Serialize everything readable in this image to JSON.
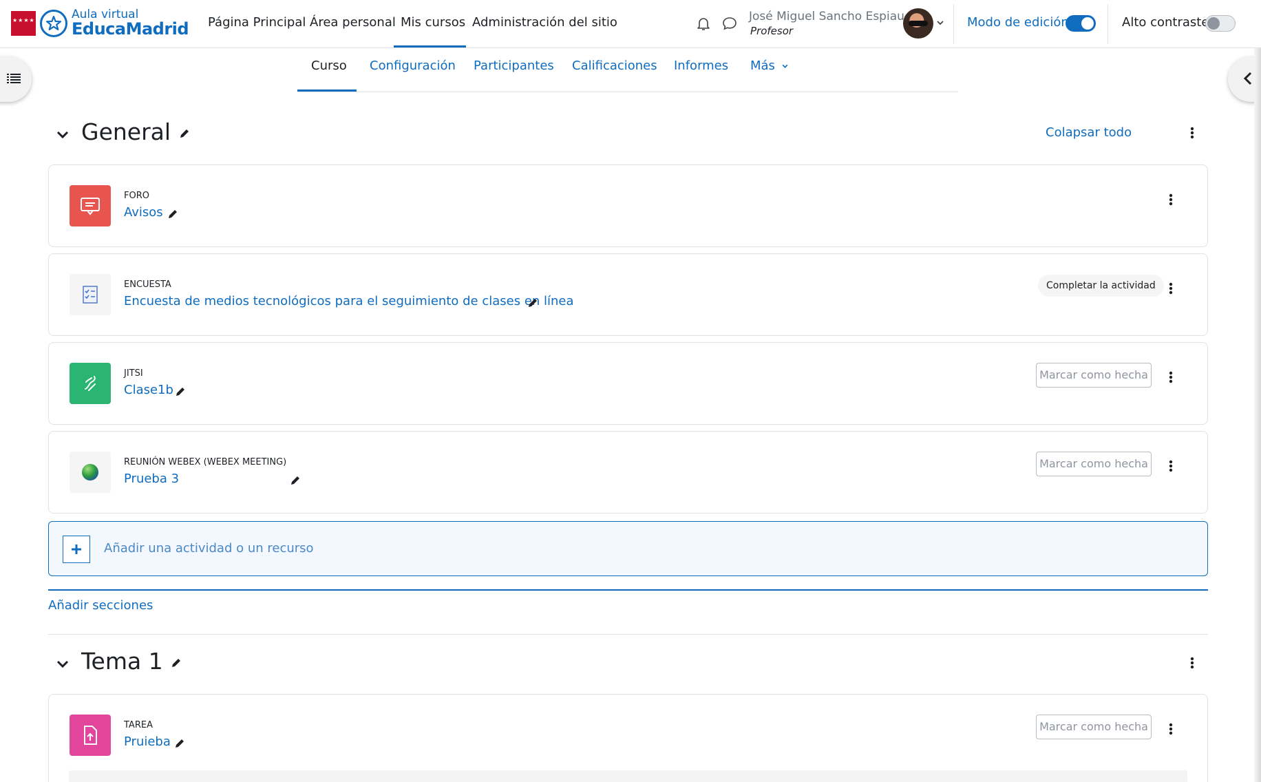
{
  "brand": {
    "top": "Aula virtual",
    "bottom": "EducaMadrid",
    "flag_stars": "★★★★",
    "brand_color": "#0f6cbf",
    "flag_color": "#c8102e"
  },
  "main_nav": {
    "items": [
      "Página Principal",
      "Área personal",
      "Mis cursos",
      "Administración del sitio"
    ],
    "active": "Mis cursos"
  },
  "header": {
    "notifications_icon": "bell-icon",
    "messages_icon": "chat-bubble-icon",
    "user_name": "José Miguel Sancho Espiau",
    "user_role": "Profesor",
    "edit_mode_label": "Modo de edición",
    "edit_mode_on": true,
    "contrast_label": "Alto contraste",
    "contrast_on": false
  },
  "course_nav": {
    "items": [
      "Curso",
      "Configuración",
      "Participantes",
      "Calificaciones",
      "Informes",
      "Más"
    ],
    "active": "Curso"
  },
  "sections": [
    {
      "title": "General",
      "collapse_all": "Colapsar todo",
      "activities": [
        {
          "type": "FORO",
          "name": "Avisos",
          "icon": "forum-icon",
          "color": "#e8544e"
        },
        {
          "type": "ENCUESTA",
          "name": "Encuesta de medios tecnológicos para el seguimiento de clases en línea",
          "icon": "survey-icon",
          "completion": "Completar la actividad"
        },
        {
          "type": "JITSI",
          "name": "Clase1b",
          "icon": "jitsi-icon",
          "color": "#2bb573",
          "completion": "Marcar como hecha"
        },
        {
          "type": "REUNIÓN WEBEX (WEBEX MEETING)",
          "name": "Prueba 3",
          "icon": "globe-icon",
          "completion": "Marcar como hecha"
        }
      ],
      "add_activity": "Añadir una actividad o un recurso"
    },
    {
      "title": "Tema 1",
      "activities": [
        {
          "type": "TAREA",
          "name": "Pruieba",
          "icon": "assignment-upload-icon",
          "color": "#e3449c",
          "completion": "Marcar como hecha"
        }
      ]
    }
  ],
  "add_sections": "Añadir secciones"
}
